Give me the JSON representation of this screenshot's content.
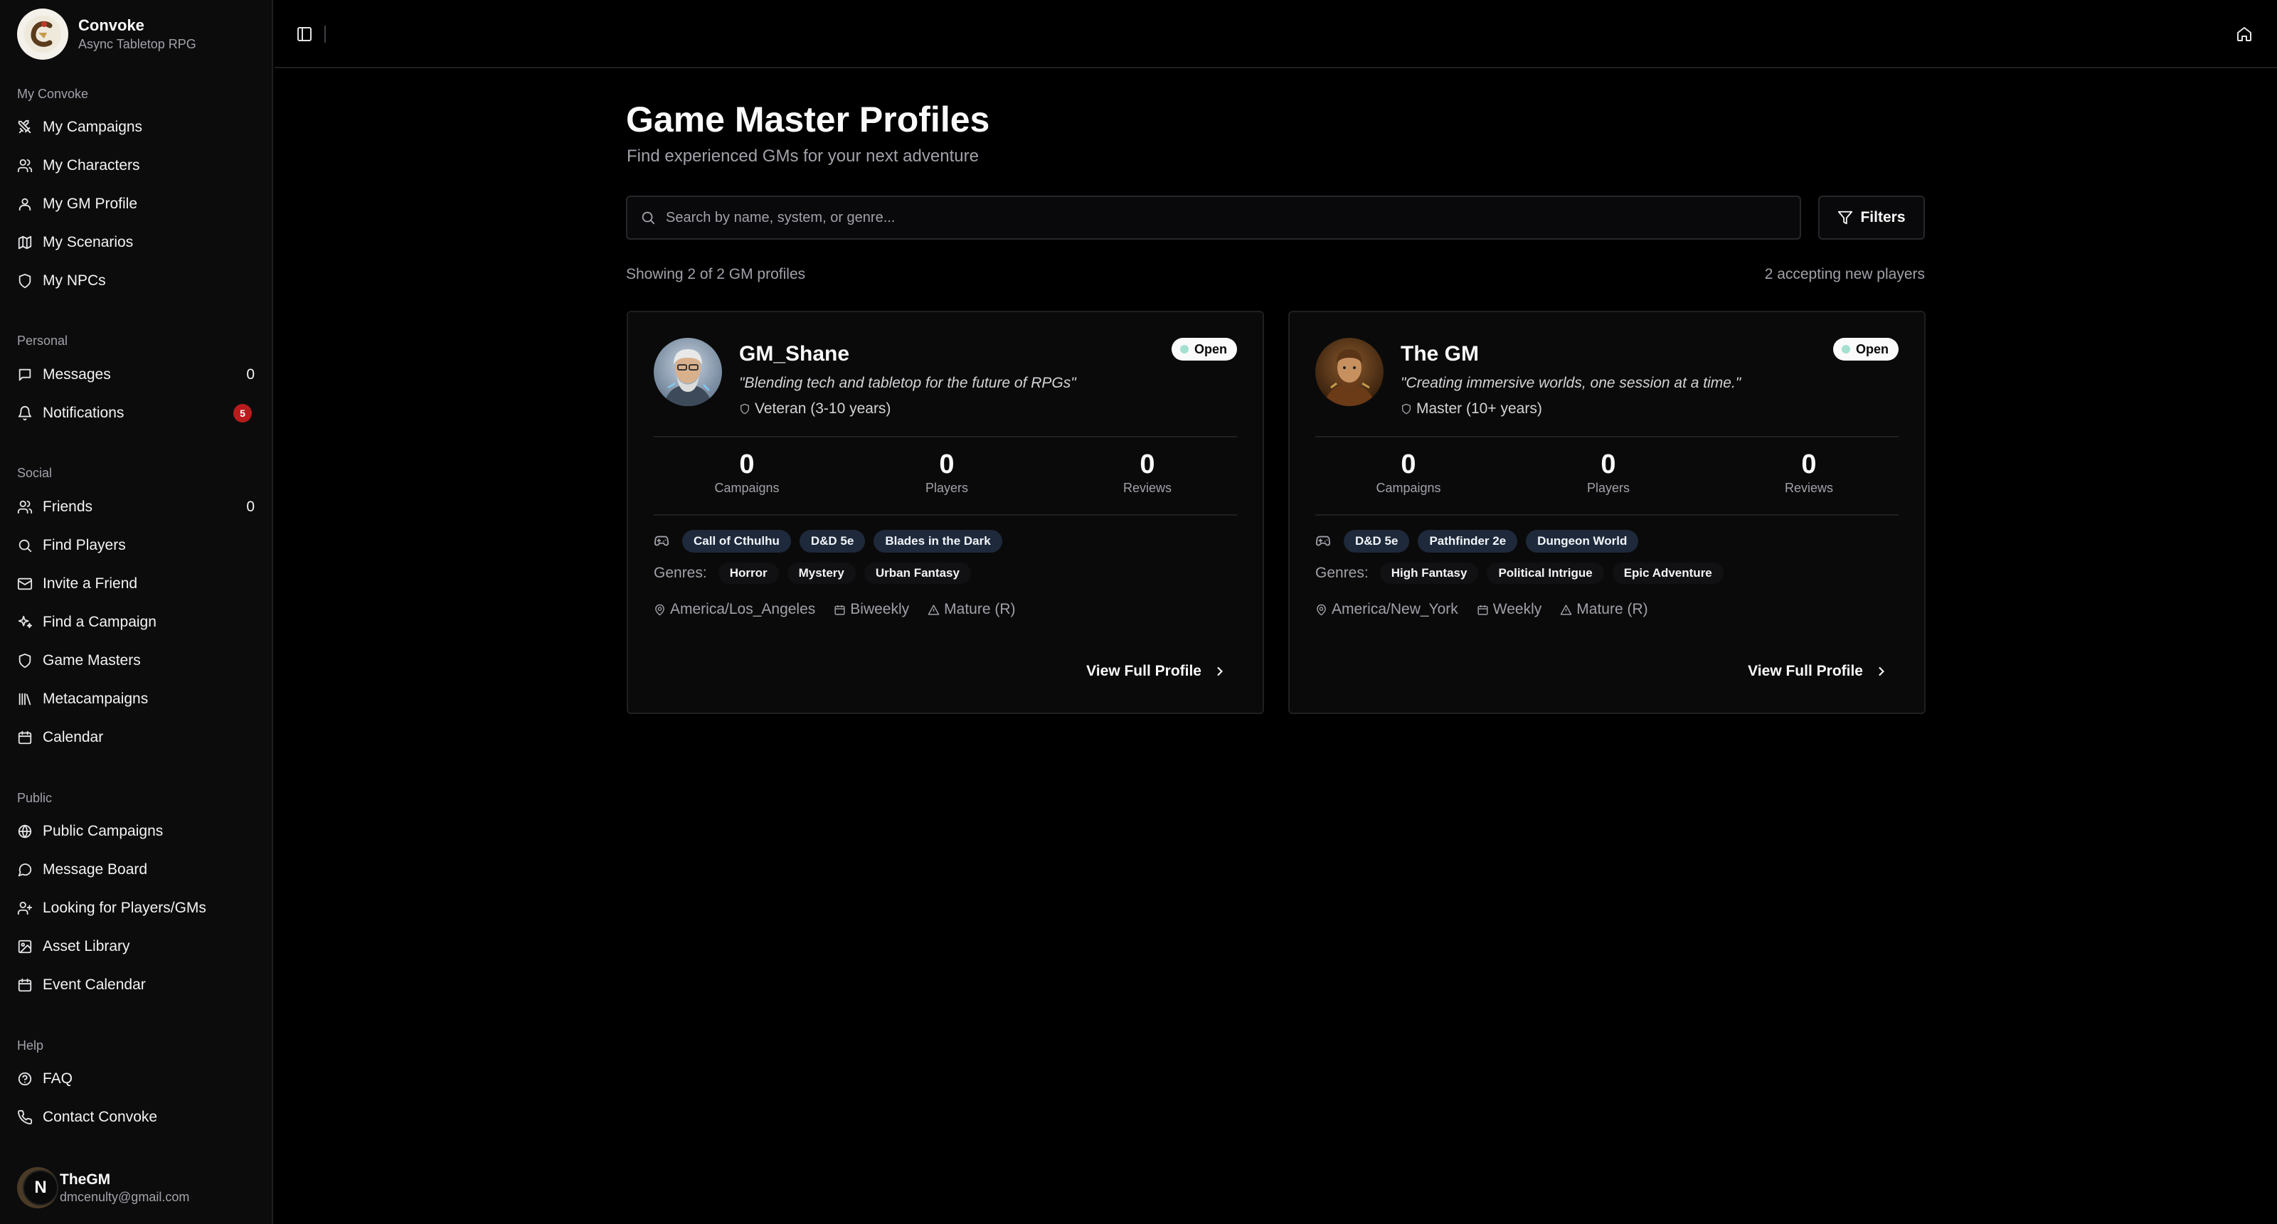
{
  "app": {
    "name": "Convoke",
    "subtitle": "Async Tabletop RPG"
  },
  "sidebar": {
    "groups": [
      {
        "label": "My Convoke",
        "items": [
          {
            "label": "My Campaigns",
            "icon": "swords-icon"
          },
          {
            "label": "My Characters",
            "icon": "users-icon"
          },
          {
            "label": "My GM Profile",
            "icon": "user-icon"
          },
          {
            "label": "My Scenarios",
            "icon": "map-icon"
          },
          {
            "label": "My NPCs",
            "icon": "shield-icon"
          }
        ]
      },
      {
        "label": "Personal",
        "items": [
          {
            "label": "Messages",
            "icon": "message-icon",
            "count": "0"
          },
          {
            "label": "Notifications",
            "icon": "bell-icon",
            "badge": "5"
          }
        ]
      },
      {
        "label": "Social",
        "items": [
          {
            "label": "Friends",
            "icon": "users-icon",
            "count": "0"
          },
          {
            "label": "Find Players",
            "icon": "search-icon"
          },
          {
            "label": "Invite a Friend",
            "icon": "mail-icon"
          },
          {
            "label": "Find a Campaign",
            "icon": "sparkles-icon"
          },
          {
            "label": "Game Masters",
            "icon": "shield-icon"
          },
          {
            "label": "Metacampaigns",
            "icon": "library-icon"
          },
          {
            "label": "Calendar",
            "icon": "calendar-icon"
          }
        ]
      },
      {
        "label": "Public",
        "items": [
          {
            "label": "Public Campaigns",
            "icon": "globe-icon"
          },
          {
            "label": "Message Board",
            "icon": "message-icon"
          },
          {
            "label": "Looking for Players/GMs",
            "icon": "user-plus-icon"
          },
          {
            "label": "Asset Library",
            "icon": "image-icon"
          },
          {
            "label": "Event Calendar",
            "icon": "calendar-icon"
          }
        ]
      },
      {
        "label": "Help",
        "items": [
          {
            "label": "FAQ",
            "icon": "help-circle-icon"
          },
          {
            "label": "Contact Convoke",
            "icon": "phone-icon"
          }
        ]
      }
    ],
    "user": {
      "name": "TheGM",
      "email": "dmcenulty@gmail.com",
      "avatar_initial": "N"
    }
  },
  "topbar": {
    "toggle_icon": "sidebar-toggle-icon",
    "home_icon": "home-icon"
  },
  "main": {
    "title": "Game Master Profiles",
    "subtitle": "Find experienced GMs for your next adventure",
    "search": {
      "placeholder": "Search by name, system, or genre..."
    },
    "filters_label": "Filters",
    "showing_text": "Showing 2 of 2 GM profiles",
    "accepting_text": "2 accepting new players",
    "genres_label": "Genres:",
    "view_label": "View Full Profile",
    "stat_labels": {
      "campaigns": "Campaigns",
      "players": "Players",
      "reviews": "Reviews"
    },
    "cards": [
      {
        "name": "GM_Shane",
        "status": "Open",
        "quote": "\"Blending tech and tabletop for the future of RPGs\"",
        "experience": "Veteran (3-10 years)",
        "stats": {
          "campaigns": "0",
          "players": "0",
          "reviews": "0"
        },
        "systems": [
          "Call of Cthulhu",
          "D&D 5e",
          "Blades in the Dark"
        ],
        "genres": [
          "Horror",
          "Mystery",
          "Urban Fantasy"
        ],
        "timezone": "America/Los_Angeles",
        "frequency": "Biweekly",
        "rating": "Mature (R)"
      },
      {
        "name": "The GM",
        "status": "Open",
        "quote": "\"Creating immersive worlds, one session at a time.\"",
        "experience": "Master (10+ years)",
        "stats": {
          "campaigns": "0",
          "players": "0",
          "reviews": "0"
        },
        "systems": [
          "D&D 5e",
          "Pathfinder 2e",
          "Dungeon World"
        ],
        "genres": [
          "High Fantasy",
          "Political Intrigue",
          "Epic Adventure"
        ],
        "timezone": "America/New_York",
        "frequency": "Weekly",
        "rating": "Mature (R)"
      }
    ]
  },
  "colors": {
    "background": "#000000",
    "sidebar": "#0c0c0d",
    "border": "#1f1f22",
    "muted_text": "#a1a1aa",
    "system_tag": "#1e293b",
    "notification_badge": "#b91c1c",
    "open_dot": "#a3e0d0"
  }
}
